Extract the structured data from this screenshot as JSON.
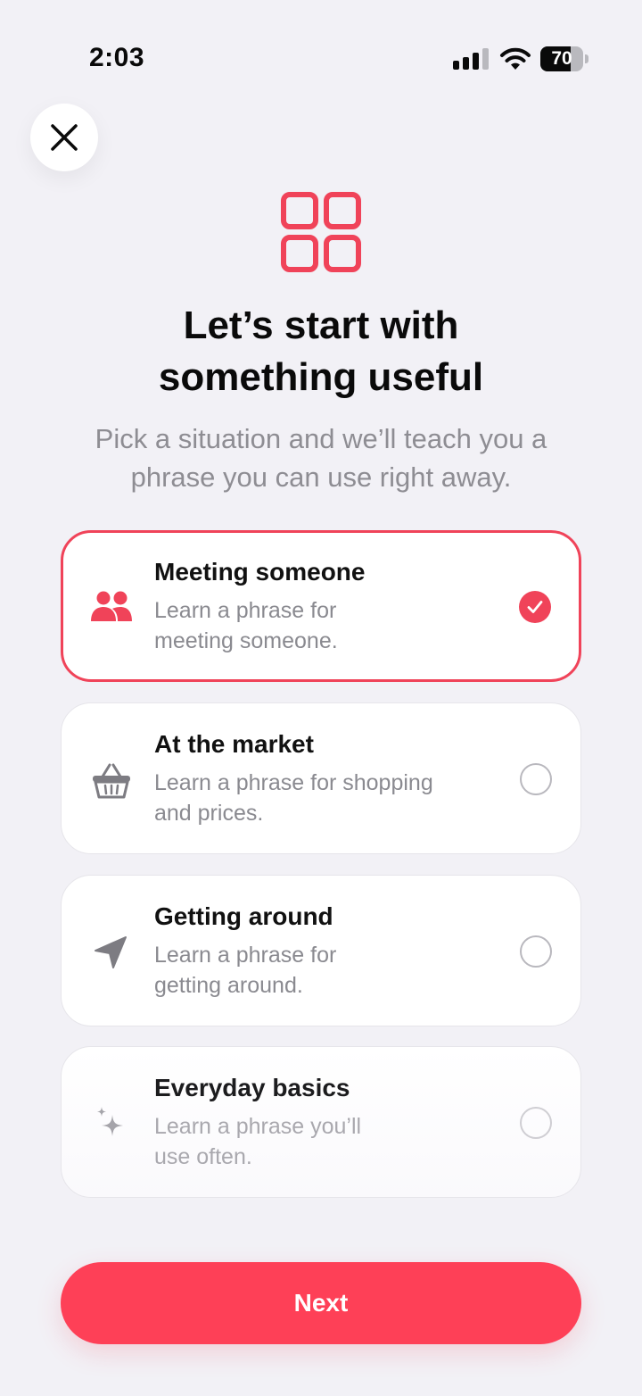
{
  "status_bar": {
    "time": "2:03",
    "battery": "70",
    "battery_level": 0.7
  },
  "header": {
    "icon": "grid-icon",
    "title_line1": "Let’s start with",
    "title_line2": "something useful",
    "subtitle_line1": "Pick a situation and we’ll teach you a",
    "subtitle_line2": "phrase you can use right away."
  },
  "options": [
    {
      "title": "Meeting someone",
      "desc_line1": "Learn a phrase for",
      "desc_line2": "meeting someone.",
      "icon": "people-icon",
      "selected": true
    },
    {
      "title": "At the market",
      "desc_line1": "Learn a phrase for shopping",
      "desc_line2": "and prices.",
      "icon": "basket-icon",
      "selected": false
    },
    {
      "title": "Getting around",
      "desc_line1": "Learn a phrase for",
      "desc_line2": "getting around.",
      "icon": "navigation-arrow-icon",
      "selected": false
    },
    {
      "title": "Everyday basics",
      "desc_line1": "Learn a phrase you’ll",
      "desc_line2": "use often.",
      "icon": "sparkles-icon",
      "selected": false
    }
  ],
  "next_button": {
    "label": "Next"
  },
  "colors": {
    "accent": "#F04359",
    "button": "#FE4057",
    "background": "#F2F1F6",
    "secondary_text": "#8E8D93"
  }
}
